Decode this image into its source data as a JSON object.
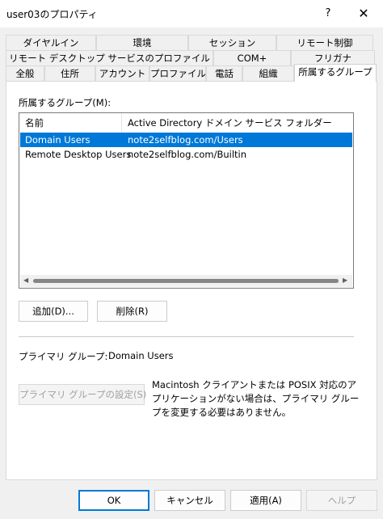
{
  "window": {
    "title": "user03のプロパティ",
    "help_label": "?",
    "close_label": "✕"
  },
  "tabs": {
    "row1": [
      "ダイヤルイン",
      "環境",
      "セッション",
      "リモート制御"
    ],
    "row2": [
      "リモート デスクトップ サービスのプロファイル",
      "COM+",
      "フリガナ"
    ],
    "row3": [
      "全般",
      "住所",
      "アカウント",
      "プロファイル",
      "電話",
      "組織",
      "所属するグループ"
    ],
    "selected": "所属するグループ"
  },
  "member_of": {
    "label": "所属するグループ(M):",
    "columns": [
      "名前",
      "Active Directory ドメイン サービス フォルダー"
    ],
    "rows": [
      {
        "name": "Domain Users",
        "folder": "note2selfblog.com/Users",
        "selected": true
      },
      {
        "name": "Remote Desktop Users",
        "folder": "note2selfblog.com/Builtin",
        "selected": false
      }
    ]
  },
  "buttons": {
    "add": "追加(D)...",
    "remove": "削除(R)",
    "set_primary": "プライマリ グループの設定(S)",
    "ok": "OK",
    "cancel": "キャンセル",
    "apply": "適用(A)",
    "help": "ヘルプ"
  },
  "primary_group": {
    "label": "プライマリ グループ:",
    "value": "Domain Users"
  },
  "note": "Macintosh クライアントまたは POSIX 対応のアプリケーションがない場合は、プライマリ グループを変更する必要はありません。"
}
